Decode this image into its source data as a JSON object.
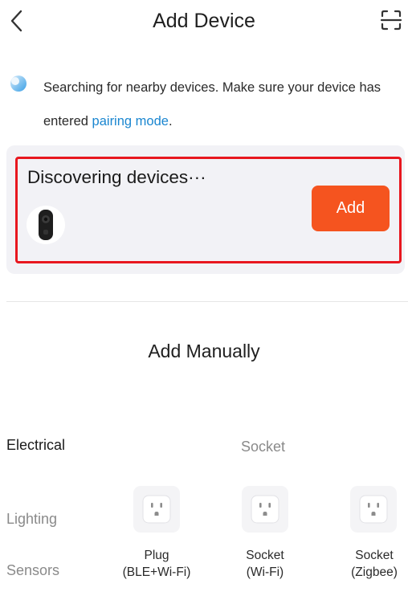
{
  "header": {
    "title": "Add Device",
    "back_icon": "chevron-left-icon",
    "scan_icon": "scan-qr-icon"
  },
  "notice": {
    "icon": "spinner-icon",
    "text_before_link": "Searching for nearby devices. Make sure your device has entered ",
    "link_text": "pairing mode",
    "text_after_link": ".",
    "link_color": "#1a86d0"
  },
  "discovery": {
    "title": "Discovering devices···",
    "device_icon": "doorbell-camera-icon",
    "add_label": "Add",
    "add_color": "#f5541f",
    "highlight_color": "#e8171f"
  },
  "manual": {
    "title": "Add Manually"
  },
  "categories": [
    {
      "label": "Electrical",
      "active": true
    },
    {
      "label": "Lighting",
      "active": false
    },
    {
      "label": "Sensors",
      "active": false
    }
  ],
  "subcategory": {
    "title": "Socket",
    "devices": [
      {
        "line1": "Plug",
        "line2": "(BLE+Wi-Fi)",
        "icon": "outlet-icon"
      },
      {
        "line1": "Socket",
        "line2": "(Wi-Fi)",
        "icon": "outlet-icon"
      },
      {
        "line1": "Socket",
        "line2": "(Zigbee)",
        "icon": "outlet-icon"
      }
    ]
  }
}
